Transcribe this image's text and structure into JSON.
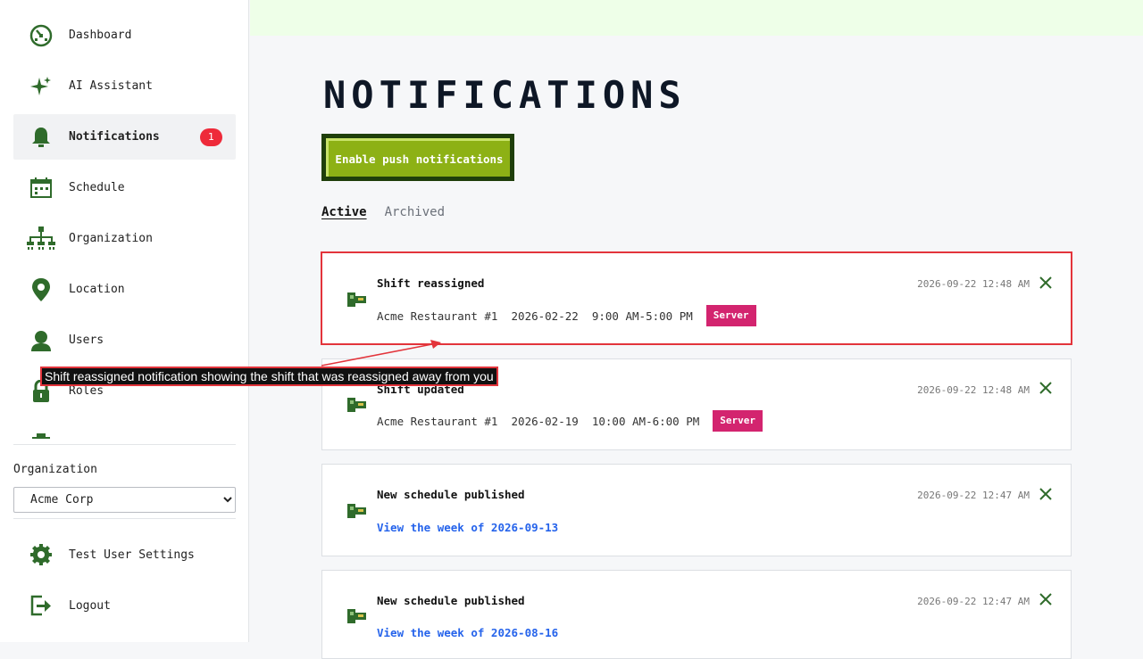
{
  "sidebar": {
    "items": [
      {
        "label": "Dashboard",
        "icon": "dashboard-icon"
      },
      {
        "label": "AI Assistant",
        "icon": "sparkle-icon"
      },
      {
        "label": "Notifications",
        "icon": "bell-icon",
        "badge": "1",
        "active": true
      },
      {
        "label": "Schedule",
        "icon": "calendar-icon"
      },
      {
        "label": "Organization",
        "icon": "org-chart-icon"
      },
      {
        "label": "Location",
        "icon": "location-pin-icon"
      },
      {
        "label": "Users",
        "icon": "user-icon"
      },
      {
        "label": "Roles",
        "icon": "lock-icon"
      }
    ],
    "org_label": "Organization",
    "org_selected": "Acme Corp",
    "settings_label": "Test User Settings",
    "logout_label": "Logout"
  },
  "main": {
    "title": "NOTIFICATIONS",
    "push_button": "Enable push notifications",
    "tabs": [
      {
        "label": "Active",
        "active": true
      },
      {
        "label": "Archived",
        "active": false
      }
    ],
    "notifications": [
      {
        "title": "Shift reassigned",
        "time": "2026-09-22 12:48 AM",
        "location": "Acme Restaurant #1",
        "date": "2026-02-22",
        "hours": "9:00 AM-5:00 PM",
        "role": "Server"
      },
      {
        "title": "Shift updated",
        "time": "2026-09-22 12:48 AM",
        "location": "Acme Restaurant #1",
        "date": "2026-02-19",
        "hours": "10:00 AM-6:00 PM",
        "role": "Server"
      },
      {
        "title": "New schedule published",
        "time": "2026-09-22 12:47 AM",
        "link": "View the week of 2026-09-13"
      },
      {
        "title": "New schedule published",
        "time": "2026-09-22 12:47 AM",
        "link": "View the week of 2026-08-16"
      }
    ]
  },
  "annotation": {
    "text": "Shift reassigned notification showing the shift that was reassigned away from you"
  },
  "colors": {
    "icon_green": "#2f6b2b",
    "accent_lime": "#8db115",
    "tag_pink": "#d3246f",
    "badge_red": "#ee2a3a",
    "link_blue": "#2563eb"
  }
}
